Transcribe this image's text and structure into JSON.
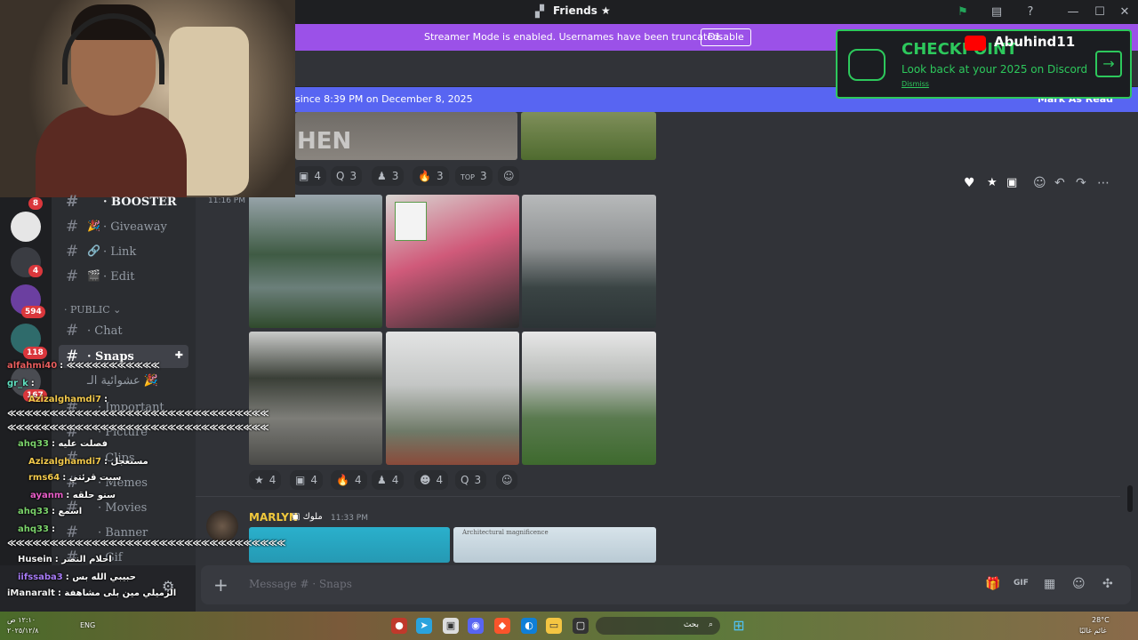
{
  "window": {
    "title": "Friends",
    "title_icon": "star-icon"
  },
  "streamer_banner": {
    "message": "Streamer Mode is enabled. Usernames have been truncated.",
    "button": "Disable"
  },
  "new_messages_bar": {
    "since": "since 8:39 PM on December 8, 2025",
    "mark_read": "Mark As Read"
  },
  "checkpoint_popup": {
    "title": "CHECKPOINT",
    "subtitle": "Look back at your 2025 on Discord",
    "dismiss": "Dismiss",
    "youtube_channel": "Abuhind11"
  },
  "server_badges": [
    "8",
    "4",
    "594",
    "118",
    "167"
  ],
  "channels": [
    {
      "emoji": "",
      "label": "· BOOSTER"
    },
    {
      "emoji": "🎉",
      "label": "· Giveaway"
    },
    {
      "emoji": "🔗",
      "label": "· Link"
    },
    {
      "emoji": "🎬",
      "label": "· Edit"
    }
  ],
  "category_public": "· PUBLIC ⌄",
  "public_channels": [
    {
      "label": "· Chat"
    },
    {
      "label": "· Snaps",
      "active": true
    },
    {
      "label": "عشوائية الـ 🎉"
    },
    {
      "label": "· Important"
    },
    {
      "label": "· Picture"
    },
    {
      "label": "· Clips"
    },
    {
      "label": "· Memes"
    },
    {
      "label": "· Movies"
    },
    {
      "label": "· Banner"
    },
    {
      "label": "· Gif"
    }
  ],
  "chat_lines": [
    {
      "user": "alfahmi40",
      "color": "#e85d5d",
      "text": ":"
    },
    {
      "user": "gr_k",
      "color": "#5fe0c0",
      "text": ":"
    },
    {
      "user": "Azizalghamdi7",
      "color": "#f2c94c",
      "text": ":"
    },
    {
      "user": "ahq33",
      "color": "#7bd36b",
      "text": ": فصلت عليه"
    },
    {
      "user": "Azizalghamdi7",
      "color": "#f2c94c",
      "text": ": مستعجل"
    },
    {
      "user": "rms64",
      "color": "#f2c94c",
      "text": ": سبت قرئتي"
    },
    {
      "user": "ayanm",
      "color": "#e85dc8",
      "text": ": سنو حلقه"
    },
    {
      "user": "ahq33",
      "color": "#7bd36b",
      "text": ": اسمع"
    },
    {
      "user": "ahq33",
      "color": "#7bd36b",
      "text": ":"
    },
    {
      "user": "Husein",
      "color": "#f2f2f2",
      "text": ": احلام النصر"
    },
    {
      "user": "iifssaba3",
      "color": "#a77bf5",
      "text": ": حبيبي الله بس"
    },
    {
      "user": "iManaralt",
      "color": "#f2f2f2",
      "text": ": الزميلي مين بلى مشاهفة"
    }
  ],
  "reactions_top": [
    {
      "icon": "avatar-emoji",
      "count": "4"
    },
    {
      "icon": "q-emoji",
      "count": "3"
    },
    {
      "icon": "figure-emoji",
      "count": "3"
    },
    {
      "icon": "fire-emoji",
      "count": "3"
    },
    {
      "icon": "top-emoji",
      "count": "3"
    }
  ],
  "message_time_1": "11:16 PM",
  "reactions_bottom": [
    {
      "glyph": "★",
      "count": "4"
    },
    {
      "glyph": "▣",
      "count": "4"
    },
    {
      "glyph": "🔥",
      "count": "4"
    },
    {
      "glyph": "♟",
      "count": "4"
    },
    {
      "glyph": "☻",
      "count": "4"
    },
    {
      "glyph": "Q",
      "count": "3"
    }
  ],
  "message_2": {
    "author": "MARLYN",
    "role_tag": "ملوك",
    "time": "11:33 PM",
    "image_caption": "Architectural magnificence"
  },
  "composer": {
    "placeholder": "Message # · Snaps"
  },
  "taskbar": {
    "lang": "ENG",
    "time": "١٢:١٠ ص",
    "date": "٢٠٢٥/١٢/٨",
    "weather": "28°C",
    "weather_desc": "غائم غالبًا",
    "search": "بحث"
  },
  "colors": {
    "accent": "#5865f2",
    "streamer": "#9b51e8",
    "checkpoint": "#2dc85c"
  }
}
